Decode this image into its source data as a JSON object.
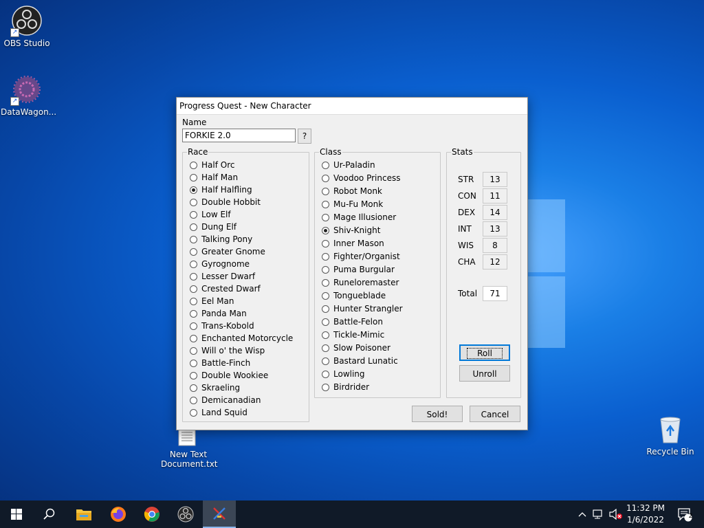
{
  "desktop": {
    "icons": [
      {
        "label": "OBS Studio"
      },
      {
        "label": "DataWagon..."
      },
      {
        "label": "New Text Document.txt"
      },
      {
        "label": "Recycle Bin"
      }
    ]
  },
  "dialog": {
    "title": "Progress Quest - New Character",
    "name_label": "Name",
    "name_value": "FORKIE 2.0",
    "random_name_label": "?",
    "race": {
      "title": "Race",
      "selected": "Half Halfling",
      "items": [
        "Half Orc",
        "Half Man",
        "Half Halfling",
        "Double Hobbit",
        "Low Elf",
        "Dung Elf",
        "Talking Pony",
        "Greater Gnome",
        "Gyrognome",
        "Lesser Dwarf",
        "Crested Dwarf",
        "Eel Man",
        "Panda Man",
        "Trans-Kobold",
        "Enchanted Motorcycle",
        "Will o' the Wisp",
        "Battle-Finch",
        "Double Wookiee",
        "Skraeling",
        "Demicanadian",
        "Land Squid"
      ]
    },
    "class": {
      "title": "Class",
      "selected": "Shiv-Knight",
      "items": [
        "Ur-Paladin",
        "Voodoo Princess",
        "Robot Monk",
        "Mu-Fu Monk",
        "Mage Illusioner",
        "Shiv-Knight",
        "Inner Mason",
        "Fighter/Organist",
        "Puma Burgular",
        "Runeloremaster",
        "Tongueblade",
        "Hunter Strangler",
        "Battle-Felon",
        "Tickle-Mimic",
        "Slow Poisoner",
        "Bastard Lunatic",
        "Lowling",
        "Birdrider"
      ]
    },
    "stats": {
      "title": "Stats",
      "items": [
        {
          "label": "STR",
          "value": "13"
        },
        {
          "label": "CON",
          "value": "11"
        },
        {
          "label": "DEX",
          "value": "14"
        },
        {
          "label": "INT",
          "value": "13"
        },
        {
          "label": "WIS",
          "value": "8"
        },
        {
          "label": "CHA",
          "value": "12"
        }
      ],
      "total_label": "Total",
      "total_value": "71",
      "roll_label": "Roll",
      "unroll_label": "Unroll"
    },
    "sold_label": "Sold!",
    "cancel_label": "Cancel"
  },
  "taskbar": {
    "time": "11:32 PM",
    "date": "1/6/2022",
    "notification_count": "2",
    "colors": {
      "background": "#101a28",
      "active": "#3b4656"
    }
  }
}
